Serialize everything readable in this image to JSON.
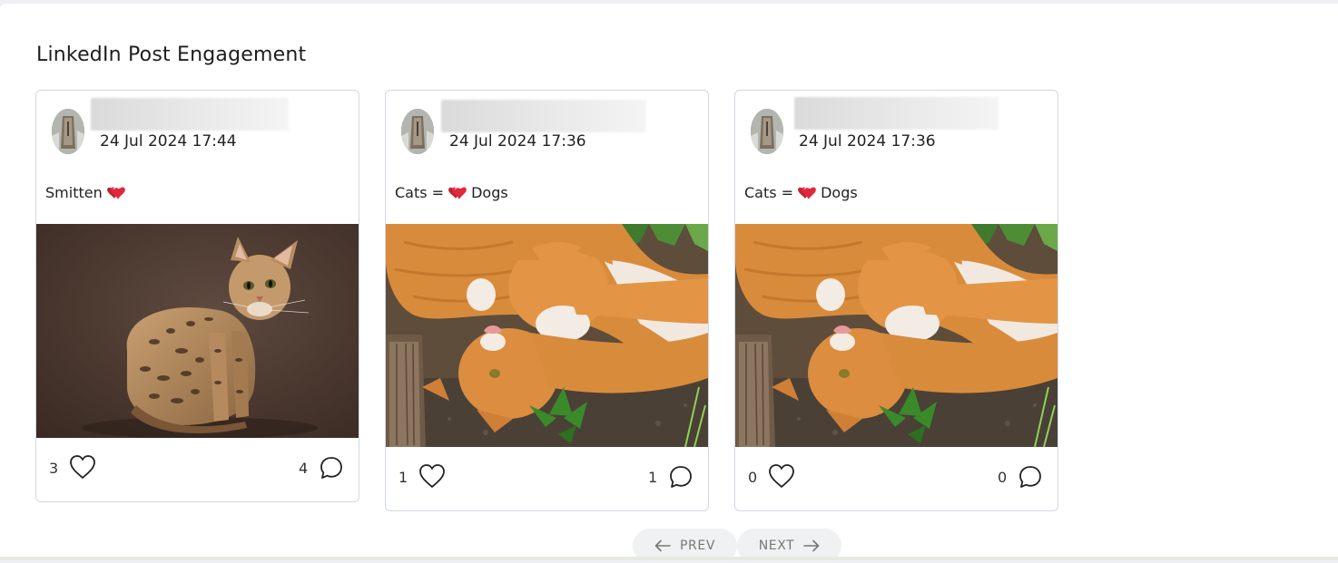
{
  "widget": {
    "title": "LinkedIn Post Engagement"
  },
  "posts": [
    {
      "date": "24 Jul 2024 17:44",
      "text": "Smitten",
      "text_after": "",
      "emoji": "heart",
      "image": "spotted-cat-photo",
      "likes": "3",
      "comments": "4"
    },
    {
      "date": "24 Jul 2024 17:36",
      "text": "Cats =",
      "text_after": "Dogs",
      "emoji": "heart",
      "image": "orange-cats-playing-photo",
      "likes": "1",
      "comments": "1"
    },
    {
      "date": "24 Jul 2024 17:36",
      "text": "Cats =",
      "text_after": "Dogs",
      "emoji": "heart",
      "image": "orange-cats-playing-photo",
      "likes": "0",
      "comments": "0"
    }
  ],
  "pagination": {
    "prev_label": "PREV",
    "next_label": "NEXT"
  },
  "icons": {
    "like": "heart-outline-icon",
    "comment": "speech-bubble-icon",
    "prev": "arrow-left-icon",
    "next": "arrow-right-icon"
  },
  "colors": {
    "card_border": "#d3d7e8",
    "heart_emoji": "#e0283c",
    "pager_bg": "#f0f1f2"
  }
}
